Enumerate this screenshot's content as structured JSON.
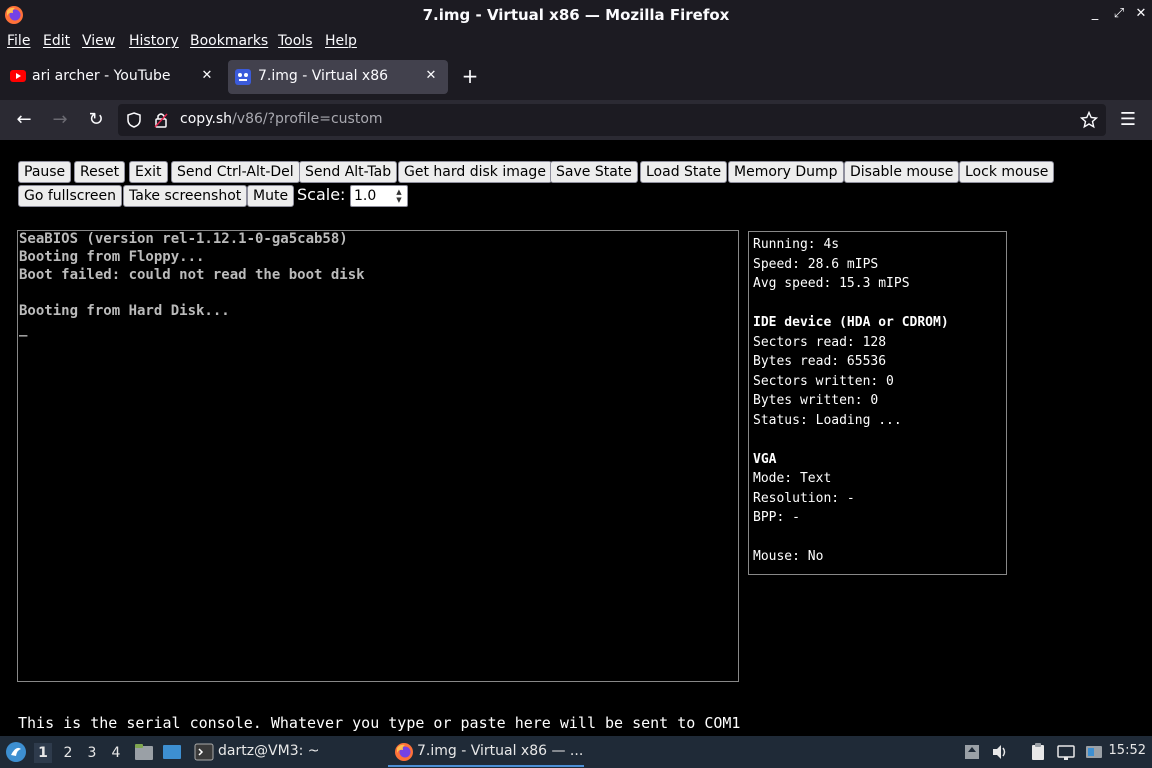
{
  "window": {
    "title": "7.img - Virtual x86 — Mozilla Firefox",
    "controls": {
      "minimize": "_",
      "maximize": "⤢",
      "close": "✕"
    }
  },
  "menu": [
    "File",
    "Edit",
    "View",
    "History",
    "Bookmarks",
    "Tools",
    "Help"
  ],
  "tabs": [
    {
      "label": "ari archer - YouTube",
      "active": false,
      "icon": "youtube-icon"
    },
    {
      "label": "7.img - Virtual x86",
      "active": true,
      "icon": "v86-icon"
    }
  ],
  "nav": {
    "url_host": "copy.sh",
    "url_path": "/v86/?profile=custom"
  },
  "toolbar": {
    "buttons_row1": [
      "Pause",
      "Reset",
      "Exit",
      "Send Ctrl-Alt-Del",
      "Send Alt-Tab",
      "Get hard disk image",
      "Save State",
      "Load State",
      "Memory Dump",
      "Disable mouse",
      "Lock mouse"
    ],
    "buttons_row2": [
      "Go fullscreen",
      "Take screenshot",
      "Mute"
    ],
    "scale_label": "Scale:",
    "scale_value": "1.0"
  },
  "screen": {
    "lines": [
      "SeaBIOS (version rel-1.12.1-0-ga5cab58)",
      "Booting from Floppy...",
      "Boot failed: could not read the boot disk",
      "",
      "Booting from Hard Disk...",
      "_"
    ]
  },
  "info": {
    "running": "Running: 4s",
    "speed": "Speed: 28.6 mIPS",
    "avg_speed": "Avg speed: 15.3 mIPS",
    "ide_heading": "IDE device (HDA or CDROM)",
    "sectors_read": "Sectors read: 128",
    "bytes_read": "Bytes read: 65536",
    "sectors_written": "Sectors written: 0",
    "bytes_written": "Bytes written: 0",
    "status": "Status: Loading ...",
    "vga_heading": "VGA",
    "mode": "Mode: Text",
    "resolution": "Resolution: -",
    "bpp": "BPP: -",
    "mouse": "Mouse: No"
  },
  "serial": {
    "text": "This is the serial console. Whatever you type or paste here will be sent to COM1"
  },
  "taskbar": {
    "workspaces": [
      "1",
      "2",
      "3",
      "4"
    ],
    "terminal_label": "dartz@VM3: ~",
    "firefox_label": "7.img - Virtual x86 — ...",
    "clock": "15:52"
  },
  "colors": {
    "chrome_dark": "#1c1b22",
    "navbar": "#2b2a33",
    "tab_active": "#42414d",
    "taskbar": "#1f2a37",
    "accent": "#4c8fd6"
  }
}
